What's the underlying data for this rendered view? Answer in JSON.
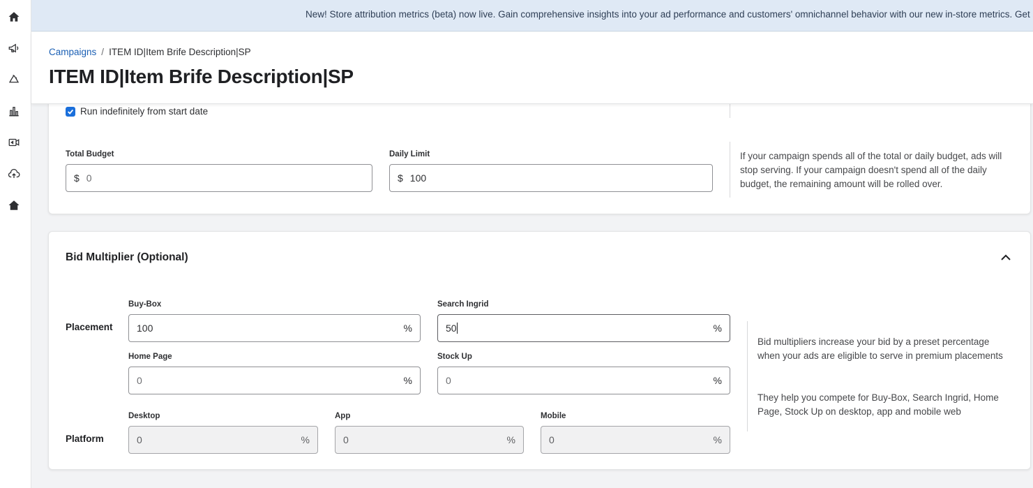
{
  "sidebar": {
    "icons": [
      "home-icon",
      "megaphone-icon",
      "recycle-icon",
      "bar-chart-icon",
      "video-camera-icon",
      "cloud-upload-icon",
      "store-home-icon"
    ]
  },
  "banner": {
    "text": "New! Store attribution metrics (beta) now live. Gain comprehensive insights into your ad performance and customers' omnichannel behavior with our new in-store metrics. Get started tod"
  },
  "header": {
    "breadcrumb_root": "Campaigns",
    "breadcrumb_separator": "/",
    "breadcrumb_current": "ITEM ID|Item Brife Description|SP",
    "title": "ITEM ID|Item Brife Description|SP"
  },
  "budget": {
    "checkbox_label": "Run indefinitely from start date",
    "checkbox_checked": true,
    "total_budget_label": "Total Budget",
    "total_budget_prefix": "$",
    "total_budget_placeholder": "0",
    "daily_limit_label": "Daily Limit",
    "daily_limit_prefix": "$",
    "daily_limit_value": "100",
    "help": "If your campaign spends all of the total or daily budget, ads will stop serving. If your campaign doesn't spend all of the daily budget, the remaining amount will be rolled over."
  },
  "bid_multiplier": {
    "title": "Bid Multiplier (Optional)",
    "placement_label": "Placement",
    "platform_label": "Platform",
    "unit": "%",
    "buy_box": {
      "label": "Buy-Box",
      "value": "100"
    },
    "search_ingrid": {
      "label": "Search Ingrid",
      "value": "50"
    },
    "home_page": {
      "label": "Home Page",
      "placeholder": "0"
    },
    "stock_up": {
      "label": "Stock Up",
      "placeholder": "0"
    },
    "desktop": {
      "label": "Desktop",
      "placeholder": "0"
    },
    "app": {
      "label": "App",
      "placeholder": "0"
    },
    "mobile": {
      "label": "Mobile",
      "placeholder": "0"
    },
    "help_1": "Bid multipliers increase your bid by a preset percentage when your ads are eligible to serve in premium placements",
    "help_2": "They help you compete for Buy-Box, Search Ingrid, Home Page, Stock Up on desktop, app and mobile web"
  },
  "colors": {
    "accent": "#1a6fdb",
    "link": "#1a5fb4",
    "banner_bg": "#dfe9f5"
  }
}
